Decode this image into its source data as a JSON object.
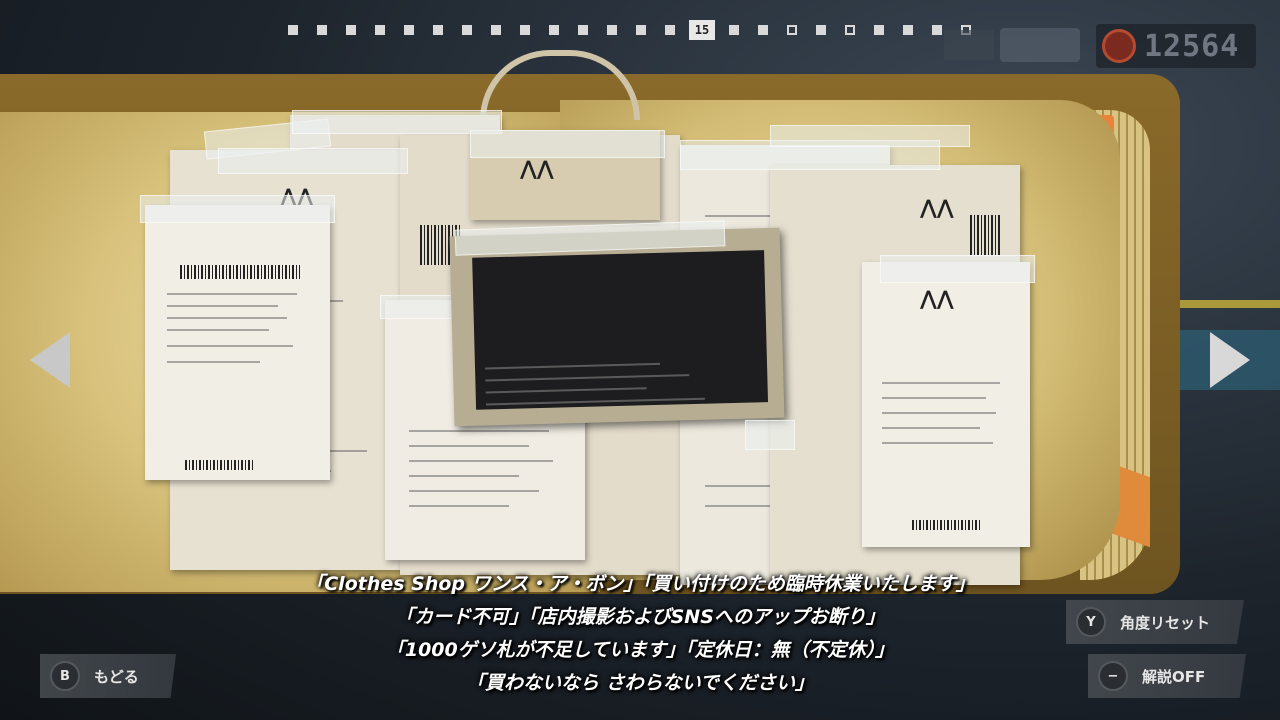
{
  "pager": {
    "current": "15",
    "dots": [
      "filled",
      "filled",
      "filled",
      "filled",
      "filled",
      "filled",
      "filled",
      "filled",
      "filled",
      "filled",
      "filled",
      "filled",
      "filled",
      "filled",
      "current",
      "filled",
      "filled",
      "hollow",
      "filled",
      "hollow",
      "filled",
      "filled",
      "filled",
      "hollow"
    ]
  },
  "score": {
    "value": "12564"
  },
  "subtitles": [
    "「Clothes Shop ワンス・ア・ボン」「買い付けのため臨時休業いたします」",
    "「カード不可」「店内撮影およびSNSへのアップお断り」",
    "「1000ゲソ札が不足しています」「定休日：無（不定休）」",
    "「買わないなら さわらないでください」"
  ],
  "buttons": {
    "back": {
      "key": "B",
      "label": "もどる"
    },
    "reset_angle": {
      "key": "Y",
      "label": "角度リセット"
    },
    "commentary": {
      "key": "−",
      "label": "解説OFF"
    }
  },
  "colors": {
    "page": "#e3d196",
    "receipt": "#eeeae0",
    "tab_orange": "#e8843a",
    "tab_pink": "#d86aa8"
  }
}
